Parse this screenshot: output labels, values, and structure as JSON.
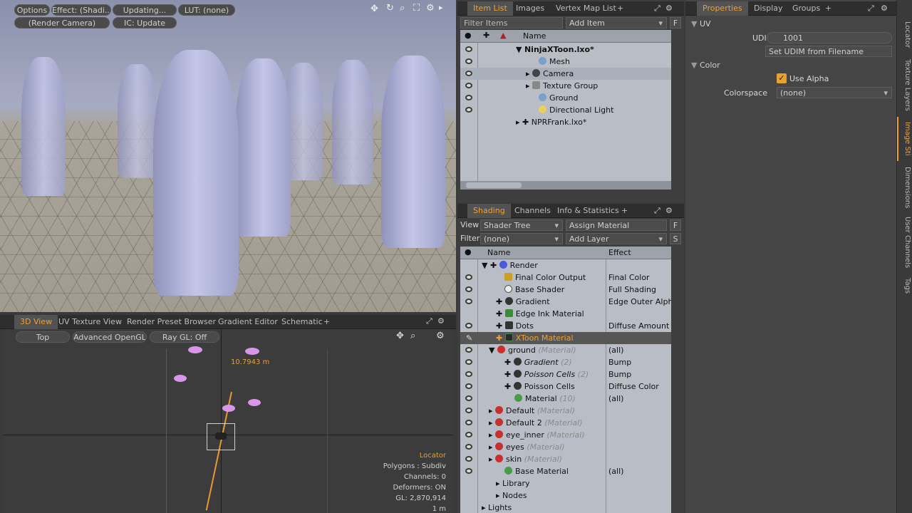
{
  "viewport": {
    "top_buttons": [
      "Options",
      "Effect: (Shadi...",
      "Updating...",
      "LUT: (none)"
    ],
    "row2_buttons": [
      "(Render Camera)",
      "IC: Update"
    ]
  },
  "bottom_tabs": [
    "3D View",
    "UV Texture View",
    "Render Preset Browser",
    "Gradient Editor",
    "Schematic",
    "+"
  ],
  "view3d": {
    "buttons": [
      "Top",
      "Advanced OpenGL",
      "Ray GL: Off"
    ],
    "measure": "10.7943 m",
    "info": {
      "title": "Locator",
      "polygons": "Polygons : Subdiv",
      "channels": "Channels: 0",
      "deformers": "Deformers: ON",
      "gl": "GL: 2,870,914",
      "scale": "1 m"
    }
  },
  "item_list": {
    "tabs": [
      "Item List",
      "Images",
      "Vertex Map List",
      "+"
    ],
    "filter_placeholder": "Filter Items",
    "add_item": "Add Item",
    "f_button": "F",
    "name_header": "Name",
    "items": [
      {
        "label": "NinjaXToon.lxo*"
      },
      {
        "label": "Mesh"
      },
      {
        "label": "Camera"
      },
      {
        "label": "Texture Group"
      },
      {
        "label": "Ground"
      },
      {
        "label": "Directional Light"
      },
      {
        "label": "NPRFrank.lxo*"
      }
    ]
  },
  "shading": {
    "tabs": [
      "Shading",
      "Channels",
      "Info & Statistics",
      "+"
    ],
    "view_label": "View",
    "view_value": "Shader Tree",
    "assign_material": "Assign Material",
    "f_button": "F",
    "filter_label": "Filter",
    "filter_value": "(none)",
    "add_layer": "Add Layer",
    "s_button": "S",
    "name_header": "Name",
    "effect_header": "Effect",
    "rows": [
      {
        "name": "Render",
        "sub": "",
        "effect": ""
      },
      {
        "name": "Final Color Output",
        "sub": "",
        "effect": "Final Color"
      },
      {
        "name": "Base Shader",
        "sub": "",
        "effect": "Full Shading"
      },
      {
        "name": "Gradient",
        "sub": "",
        "effect": "Edge Outer Alpha"
      },
      {
        "name": "Edge Ink Material",
        "sub": "",
        "effect": ""
      },
      {
        "name": "Dots",
        "sub": "",
        "effect": "Diffuse Amount"
      },
      {
        "name": "XToon Material",
        "sub": "",
        "effect": ""
      },
      {
        "name": "ground",
        "sub": "(Material)",
        "effect": "(all)"
      },
      {
        "name": "Gradient",
        "sub": "(2)",
        "effect": "Bump"
      },
      {
        "name": "Poisson Cells",
        "sub": "(2)",
        "effect": "Bump"
      },
      {
        "name": "Poisson Cells",
        "sub": "",
        "effect": "Diffuse Color"
      },
      {
        "name": "Material",
        "sub": "(10)",
        "effect": "(all)"
      },
      {
        "name": "Default",
        "sub": "(Material)",
        "effect": ""
      },
      {
        "name": "Default 2",
        "sub": "(Material)",
        "effect": ""
      },
      {
        "name": "eye_inner",
        "sub": "(Material)",
        "effect": ""
      },
      {
        "name": "eyes",
        "sub": "(Material)",
        "effect": ""
      },
      {
        "name": "skin",
        "sub": "(Material)",
        "effect": ""
      },
      {
        "name": "Base Material",
        "sub": "",
        "effect": "(all)"
      },
      {
        "name": "Library",
        "sub": "",
        "effect": ""
      },
      {
        "name": "Nodes",
        "sub": "",
        "effect": ""
      },
      {
        "name": "Lights",
        "sub": "",
        "effect": ""
      }
    ]
  },
  "properties": {
    "tabs": [
      "Properties",
      "Display",
      "Groups",
      "+"
    ],
    "uv_section": "UV",
    "udim_label": "UDIM",
    "udim_value": "1001",
    "set_udim_button": "Set UDIM from Filename",
    "color_section": "Color",
    "use_alpha": "Use Alpha",
    "colorspace_label": "Colorspace",
    "colorspace_value": "(none)"
  },
  "side_tabs": [
    "Locator",
    "Texture Layers",
    "Image Sti",
    "Dimensions",
    "User Channels",
    "Tags"
  ]
}
